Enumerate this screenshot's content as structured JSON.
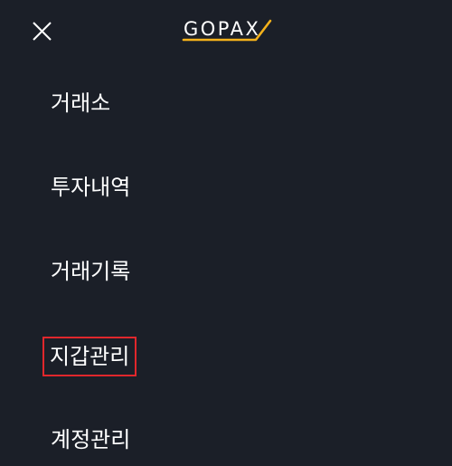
{
  "header": {
    "logo_text": "GOPAX",
    "close_icon": "close-icon",
    "accent_color": "#f5b21b"
  },
  "menu": {
    "items": [
      {
        "label": "거래소"
      },
      {
        "label": "투자내역"
      },
      {
        "label": "거래기록"
      },
      {
        "label": "지갑관리",
        "highlighted": true
      },
      {
        "label": "계정관리"
      }
    ]
  },
  "colors": {
    "background": "#1b1f28",
    "text": "#ffffff",
    "highlight_border": "#e1272c"
  }
}
